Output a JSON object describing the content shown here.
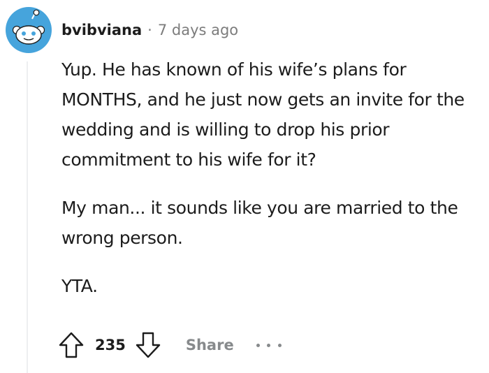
{
  "comment": {
    "username": "bvibviana",
    "separator": "·",
    "timestamp": "7 days ago",
    "paragraphs": [
      "Yup. He has known of his wife’s plans for MONTHS, and he just now gets an invite for the wedding and is willing to drop his prior commitment to his wife for it?",
      "My man... it sounds like you are married to the wrong person.",
      "YTA."
    ]
  },
  "actions": {
    "score": "235",
    "share_label": "Share"
  },
  "colors": {
    "avatar_blue": "#46a4dc",
    "meta_gray": "#7c7c7c",
    "icon_gray": "#878a8c",
    "thread_line": "#edeff1"
  },
  "icons": {
    "avatar": "snoo-avatar-icon",
    "upvote": "upvote-arrow-icon",
    "downvote": "downvote-arrow-icon",
    "more": "ellipsis-icon"
  }
}
